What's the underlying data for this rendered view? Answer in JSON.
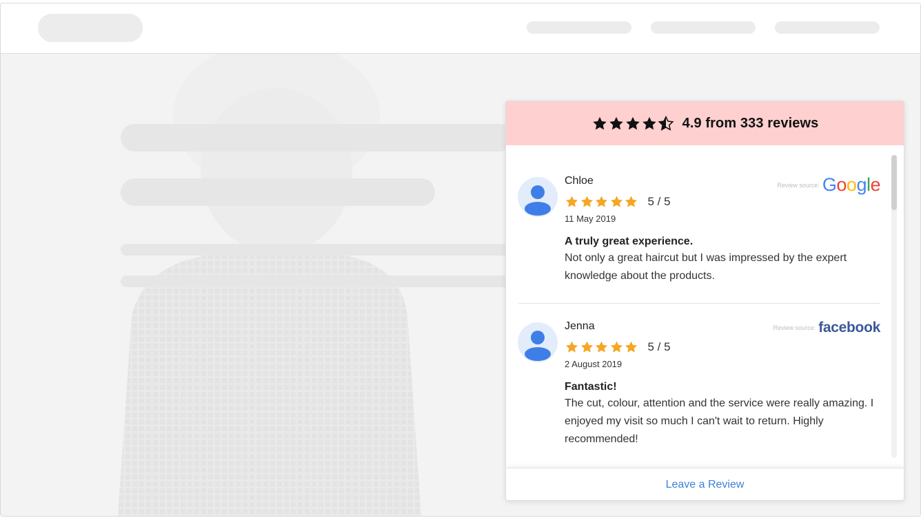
{
  "widget": {
    "summary": "4.9 from 333 reviews",
    "overall_rating": 4.5,
    "star_color_header": "#111111",
    "star_color_review": "#f5a623",
    "header_bg": "#ffd0d0",
    "accent": "#3b82d9",
    "reviews": [
      {
        "name": "Chloe",
        "rating_text": "5 / 5",
        "rating": 5,
        "date": "11 May 2019",
        "title": "A truly great experience.",
        "text": "Not only a great haircut but I was impressed by the expert knowledge about the products.",
        "source_label": "Review source:",
        "source": "Google"
      },
      {
        "name": "Jenna",
        "rating_text": "5 / 5",
        "rating": 5,
        "date": "2 August 2019",
        "title": "Fantastic!",
        "text": "The cut, colour, attention and the service were really amazing. I enjoyed my visit so much I can't wait to return. Highly recommended!",
        "source_label": "Review source:",
        "source": "facebook"
      }
    ],
    "footer_link": "Leave a Review"
  }
}
